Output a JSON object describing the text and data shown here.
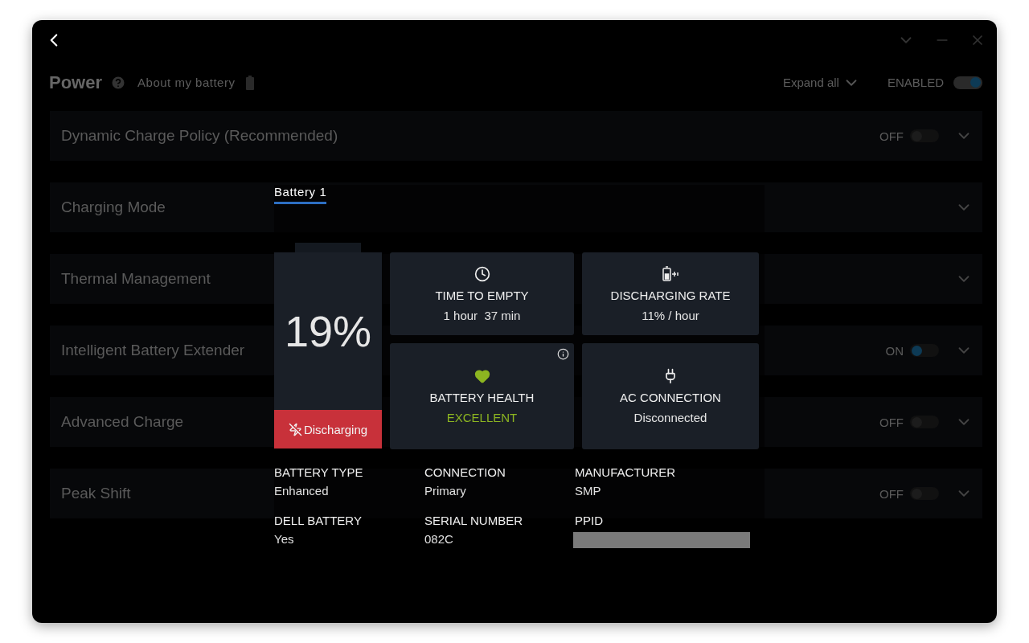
{
  "header": {
    "title": "Power",
    "link": "About my battery",
    "expand_all": "Expand all",
    "master": {
      "label": "ENABLED",
      "on": true
    }
  },
  "sections": [
    {
      "title": "Dynamic Charge Policy (Recommended)",
      "toggle": {
        "label": "OFF",
        "on": false
      }
    },
    {
      "title": "Charging Mode"
    },
    {
      "title": "Thermal Management"
    },
    {
      "title": "Intelligent Battery Extender",
      "toggle": {
        "label": "ON",
        "on": true
      }
    },
    {
      "title": "Advanced Charge",
      "toggle": {
        "label": "OFF",
        "on": false
      }
    },
    {
      "title": "Peak Shift",
      "toggle": {
        "label": "OFF",
        "on": false
      }
    }
  ],
  "tabs": [
    {
      "label": "Battery 1",
      "selected": true
    }
  ],
  "battery": {
    "percent": "19%",
    "status": {
      "label": "Discharging",
      "charging": false
    }
  },
  "tiles": [
    {
      "kind": "time",
      "title": "TIME TO EMPTY",
      "value": "1 hour  37 min",
      "info": false
    },
    {
      "kind": "rate",
      "title": "DISCHARGING RATE",
      "value": "11% / hour",
      "info": false
    },
    {
      "kind": "health",
      "title": "BATTERY HEALTH",
      "value": "EXCELLENT",
      "info": true
    },
    {
      "kind": "ac",
      "title": "AC CONNECTION",
      "value": "Disconnected",
      "info": false
    }
  ],
  "details": [
    {
      "label": "BATTERY TYPE",
      "value": "Enhanced"
    },
    {
      "label": "CONNECTION",
      "value": "Primary"
    },
    {
      "label": "MANUFACTURER",
      "value": "SMP"
    },
    {
      "label": "DELL BATTERY",
      "value": "Yes"
    },
    {
      "label": "SERIAL NUMBER",
      "value": "082C"
    },
    {
      "label": "PPID",
      "redacted": true
    }
  ]
}
